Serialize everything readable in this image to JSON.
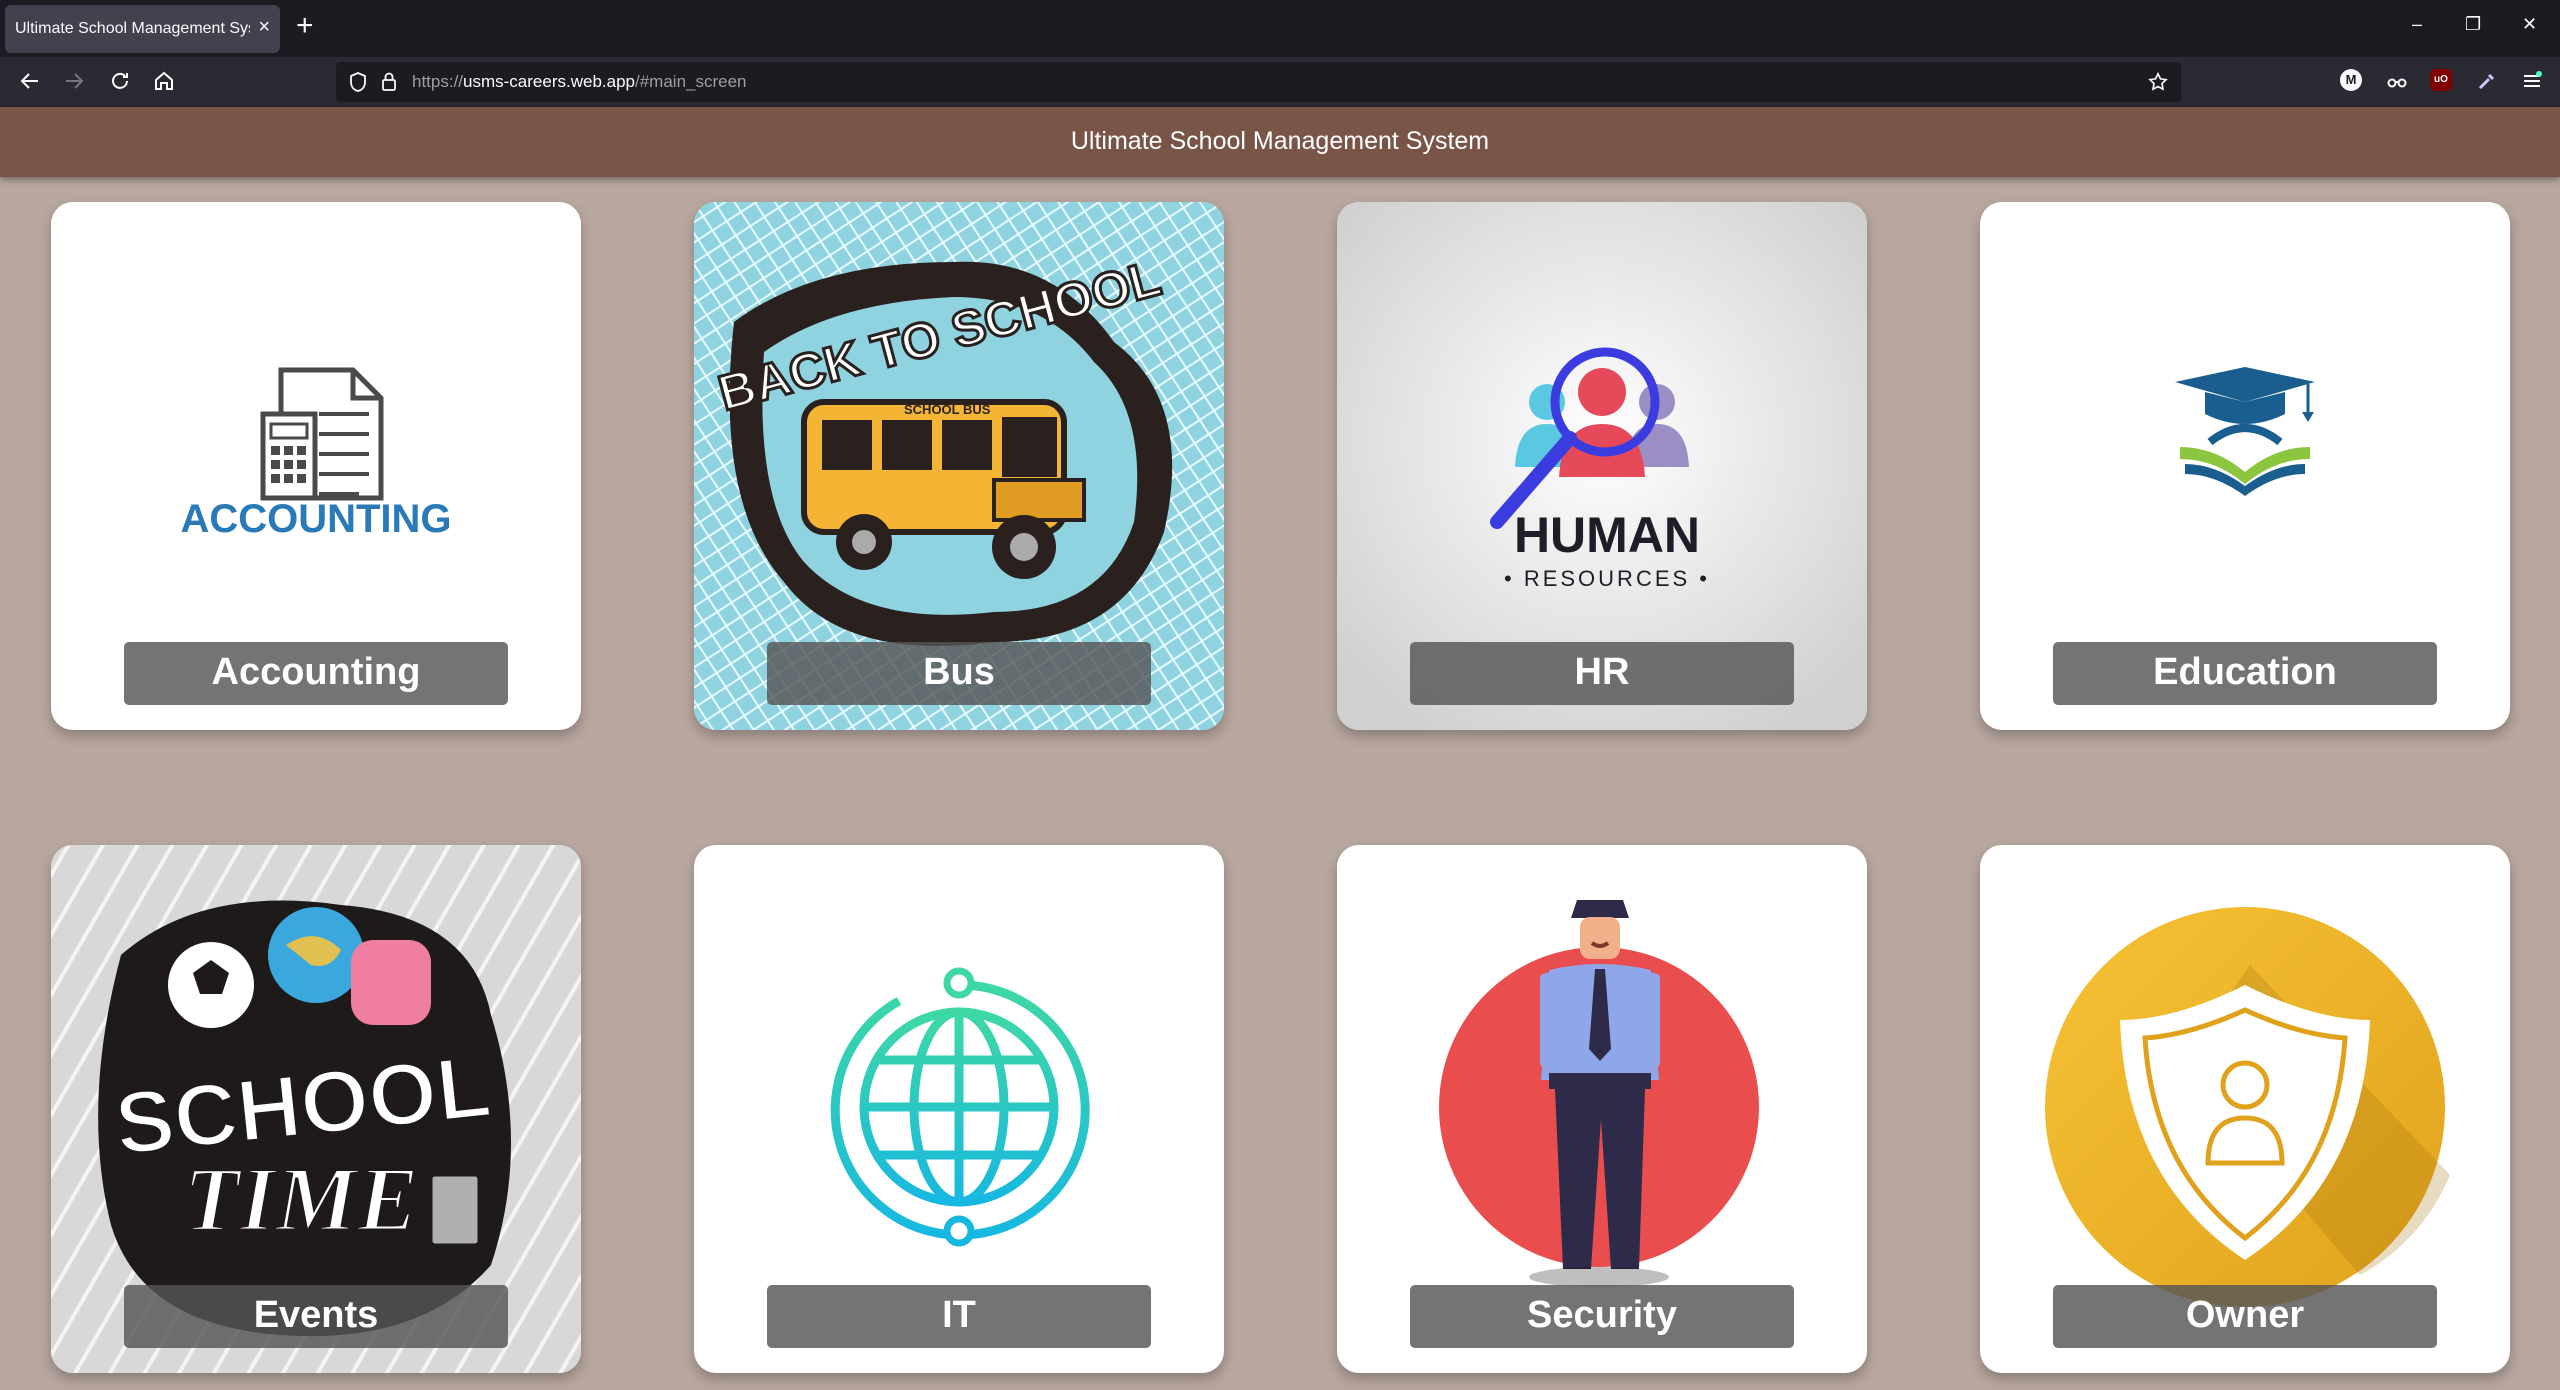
{
  "browser": {
    "tab_title": "Ultimate School Management System",
    "tab_close": "×",
    "new_tab": "+",
    "url_prefix": "https://",
    "url_host": "usms-careers.web.app",
    "url_path": "/#main_screen",
    "window_controls": [
      "–",
      "❐",
      "✕"
    ]
  },
  "app": {
    "title": "Ultimate School Management System"
  },
  "cards": [
    {
      "label": "Accounting",
      "image_text": "ACCOUNTING"
    },
    {
      "label": "Bus",
      "image_text": "BACK TO SCHOOL",
      "image_subtext": "SCHOOL BUS"
    },
    {
      "label": "HR",
      "image_text": "HUMAN",
      "image_subtext": "• RESOURCES •"
    },
    {
      "label": "Education"
    },
    {
      "label": "Events",
      "image_text": "SCHOOL",
      "image_subtext": "TIME"
    },
    {
      "label": "IT"
    },
    {
      "label": "Security"
    },
    {
      "label": "Owner"
    }
  ],
  "colors": {
    "page_bg": "#b8a79f",
    "appbar": "#795548",
    "label_bg": "#555555",
    "accounting_blue": "#2a7ab8"
  }
}
